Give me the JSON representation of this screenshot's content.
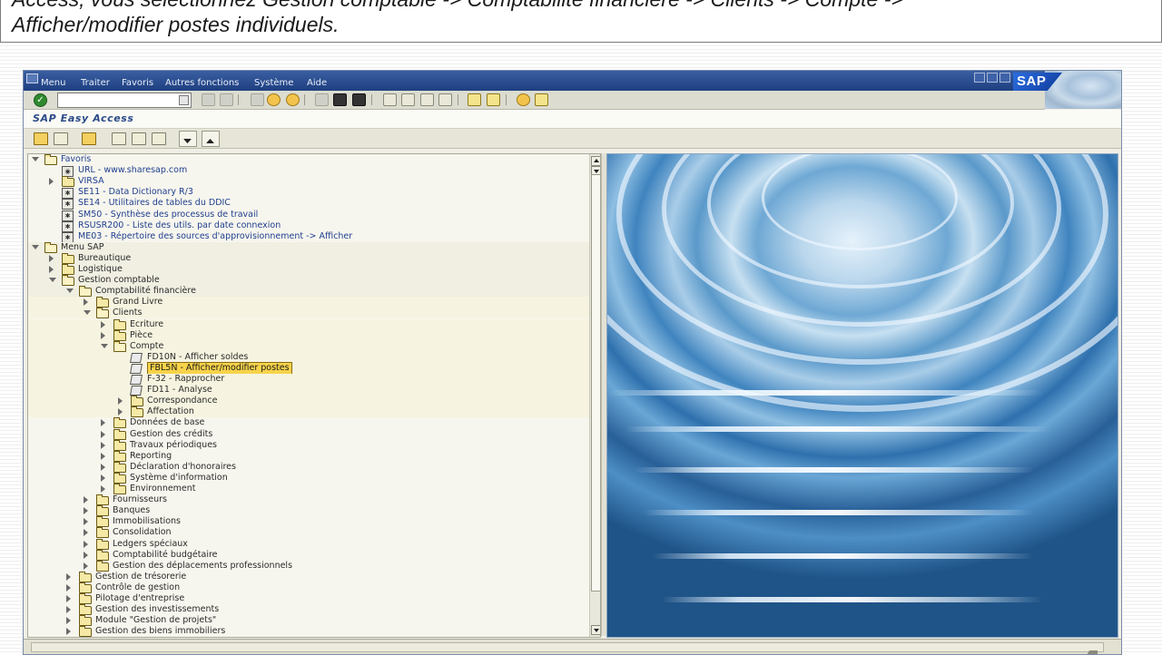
{
  "caption": {
    "line1": "Access, vous sélectionnez Gestion comptable -> Comptabilité financière -> Clients -> Compte ->",
    "line2": "Afficher/modifier postes individuels."
  },
  "sap": {
    "menu": [
      "Menu",
      "Traiter",
      "Favoris",
      "Autres fonctions",
      "Système",
      "Aide"
    ],
    "logo_text": "SAP",
    "command_field_value": "",
    "screen_title": "SAP Easy Access"
  },
  "tree": [
    {
      "level": 0,
      "toggle": "open",
      "icon": "folder-open",
      "label": "Favoris",
      "style": "blue"
    },
    {
      "level": 1,
      "toggle": "none",
      "icon": "web",
      "label": "URL - www.sharesap.com",
      "style": "blue"
    },
    {
      "level": 1,
      "toggle": "closed",
      "icon": "folder",
      "label": "VIRSA",
      "style": "blue"
    },
    {
      "level": 1,
      "toggle": "none",
      "icon": "tx",
      "label": "SE11 - Data Dictionary R/3",
      "style": "blue"
    },
    {
      "level": 1,
      "toggle": "none",
      "icon": "tx",
      "label": "SE14 - Utilitaires de tables du DDIC",
      "style": "blue"
    },
    {
      "level": 1,
      "toggle": "none",
      "icon": "tx",
      "label": "SM50 - Synthèse des processus de travail",
      "style": "blue"
    },
    {
      "level": 1,
      "toggle": "none",
      "icon": "tx",
      "label": "RSUSR200 - Liste des utils. par date connexion",
      "style": "blue"
    },
    {
      "level": 1,
      "toggle": "none",
      "icon": "tx",
      "label": "ME03 - Répertoire des sources d'approvisionnement -> Afficher",
      "style": "blue"
    },
    {
      "level": 0,
      "toggle": "open",
      "icon": "folder-open",
      "label": "Menu SAP",
      "style": "normal"
    },
    {
      "level": 1,
      "toggle": "closed",
      "icon": "folder",
      "label": "Bureautique",
      "style": "normal"
    },
    {
      "level": 1,
      "toggle": "closed",
      "icon": "folder",
      "label": "Logistique",
      "style": "normal"
    },
    {
      "level": 1,
      "toggle": "open",
      "icon": "folder-open",
      "label": "Gestion comptable",
      "style": "normal"
    },
    {
      "level": 2,
      "toggle": "open",
      "icon": "folder-open",
      "label": "Comptabilité financière",
      "style": "normal"
    },
    {
      "level": 3,
      "toggle": "closed",
      "icon": "folder",
      "label": "Grand Livre",
      "style": "normal"
    },
    {
      "level": 3,
      "toggle": "open",
      "icon": "folder-open",
      "label": "Clients",
      "style": "normal"
    },
    {
      "level": 4,
      "toggle": "closed",
      "icon": "folder",
      "label": "Ecriture",
      "style": "normal"
    },
    {
      "level": 4,
      "toggle": "closed",
      "icon": "folder",
      "label": "Pièce",
      "style": "normal"
    },
    {
      "level": 4,
      "toggle": "open",
      "icon": "folder-open",
      "label": "Compte",
      "style": "normal"
    },
    {
      "level": 5,
      "toggle": "none",
      "icon": "cube",
      "label": "FD10N - Afficher soldes",
      "style": "normal"
    },
    {
      "level": 5,
      "toggle": "none",
      "icon": "cube",
      "label": "FBL5N - Afficher/modifier postes",
      "style": "selected"
    },
    {
      "level": 5,
      "toggle": "none",
      "icon": "cube",
      "label": "F-32 - Rapprocher",
      "style": "normal"
    },
    {
      "level": 5,
      "toggle": "none",
      "icon": "cube",
      "label": "FD11 - Analyse",
      "style": "normal"
    },
    {
      "level": 5,
      "toggle": "closed",
      "icon": "folder",
      "label": "Correspondance",
      "style": "normal"
    },
    {
      "level": 5,
      "toggle": "closed",
      "icon": "folder",
      "label": "Affectation",
      "style": "normal"
    },
    {
      "level": 4,
      "toggle": "closed",
      "icon": "folder",
      "label": "Données de base",
      "style": "normal"
    },
    {
      "level": 4,
      "toggle": "closed",
      "icon": "folder",
      "label": "Gestion des crédits",
      "style": "normal"
    },
    {
      "level": 4,
      "toggle": "closed",
      "icon": "folder",
      "label": "Travaux périodiques",
      "style": "normal"
    },
    {
      "level": 4,
      "toggle": "closed",
      "icon": "folder",
      "label": "Reporting",
      "style": "normal"
    },
    {
      "level": 4,
      "toggle": "closed",
      "icon": "folder",
      "label": "Déclaration d'honoraires",
      "style": "normal"
    },
    {
      "level": 4,
      "toggle": "closed",
      "icon": "folder",
      "label": "Système d'information",
      "style": "normal"
    },
    {
      "level": 4,
      "toggle": "closed",
      "icon": "folder",
      "label": "Environnement",
      "style": "normal"
    },
    {
      "level": 3,
      "toggle": "closed",
      "icon": "folder",
      "label": "Fournisseurs",
      "style": "normal"
    },
    {
      "level": 3,
      "toggle": "closed",
      "icon": "folder",
      "label": "Banques",
      "style": "normal"
    },
    {
      "level": 3,
      "toggle": "closed",
      "icon": "folder",
      "label": "Immobilisations",
      "style": "normal"
    },
    {
      "level": 3,
      "toggle": "closed",
      "icon": "folder",
      "label": "Consolidation",
      "style": "normal"
    },
    {
      "level": 3,
      "toggle": "closed",
      "icon": "folder",
      "label": "Ledgers spéciaux",
      "style": "normal"
    },
    {
      "level": 3,
      "toggle": "closed",
      "icon": "folder",
      "label": "Comptabilité budgétaire",
      "style": "normal"
    },
    {
      "level": 3,
      "toggle": "closed",
      "icon": "folder",
      "label": "Gestion des déplacements professionnels",
      "style": "normal"
    },
    {
      "level": 2,
      "toggle": "closed",
      "icon": "folder",
      "label": "Gestion de trésorerie",
      "style": "normal"
    },
    {
      "level": 2,
      "toggle": "closed",
      "icon": "folder",
      "label": "Contrôle de gestion",
      "style": "normal"
    },
    {
      "level": 2,
      "toggle": "closed",
      "icon": "folder",
      "label": "Pilotage d'entreprise",
      "style": "normal"
    },
    {
      "level": 2,
      "toggle": "closed",
      "icon": "folder",
      "label": "Gestion des investissements",
      "style": "normal"
    },
    {
      "level": 2,
      "toggle": "closed",
      "icon": "folder",
      "label": "Module \"Gestion de projets\"",
      "style": "normal"
    },
    {
      "level": 2,
      "toggle": "closed",
      "icon": "folder",
      "label": "Gestion des biens immobiliers",
      "style": "normal"
    }
  ]
}
